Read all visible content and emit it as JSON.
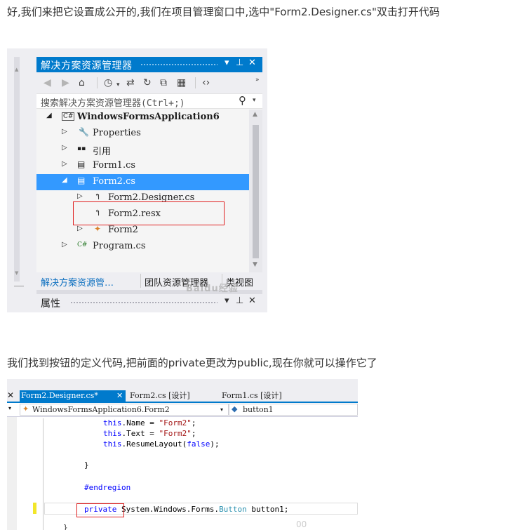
{
  "text": {
    "para1": "好,我们来把它设置成公开的,我们在项目管理窗口中,选中\"Form2.Designer.cs\"双击打开代码",
    "para2": "我们找到按钮的定义代码,把前面的private更改为public,现在你就可以操作它了"
  },
  "solution_explorer": {
    "title": "解决方案资源管理器",
    "title_controls": [
      "▾",
      "⊥",
      "✕"
    ],
    "search_placeholder": "搜索解决方案资源管理器(Ctrl+;)",
    "tree": [
      {
        "label": "WindowsFormsApplication6",
        "icon": "C#",
        "expander": "◢",
        "indent": 0,
        "bold": true
      },
      {
        "label": "Properties",
        "icon": "🔧",
        "expander": "▷",
        "indent": 1
      },
      {
        "label": "引用",
        "icon": "▪▪",
        "expander": "▷",
        "indent": 1
      },
      {
        "label": "Form1.cs",
        "icon": "▤",
        "expander": "▷",
        "indent": 1
      },
      {
        "label": "Form2.cs",
        "icon": "▤",
        "expander": "◢",
        "indent": 1,
        "selected": true
      },
      {
        "label": "Form2.Designer.cs",
        "icon": "↰",
        "expander": "▷",
        "indent": 2
      },
      {
        "label": "Form2.resx",
        "icon": "↰",
        "expander": "",
        "indent": 2
      },
      {
        "label": "Form2",
        "icon": "✦",
        "expander": "▷",
        "indent": 2
      },
      {
        "label": "Program.cs",
        "icon": "C#",
        "expander": "▷",
        "indent": 1
      }
    ],
    "tabs": [
      "解决方案资源管…",
      "团队资源管理器",
      "类视图"
    ],
    "props_title": "属性",
    "watermark": "Baidu经验"
  },
  "editor": {
    "tabs": [
      {
        "label": "Form2.Designer.cs*",
        "active": true
      },
      {
        "label": "Form2.cs [设计]"
      },
      {
        "label": "Form1.cs [设计]"
      }
    ],
    "nav_left": "WindowsFormsApplication6.Form2",
    "nav_right": "button1",
    "code": {
      "line1": [
        "this",
        ".Name = ",
        "\"Form2\"",
        ";"
      ],
      "line2": [
        "this",
        ".Text = ",
        "\"Form2\"",
        ";"
      ],
      "line3": [
        "this",
        ".ResumeLayout(",
        "false",
        ");"
      ],
      "line4": "}",
      "line5": "#endregion",
      "line6": [
        "private",
        " System.Windows.Forms.",
        "Button",
        " button1;"
      ],
      "line7": "}"
    },
    "watermark": "00"
  },
  "colors": {
    "accent": "#007acc",
    "selection": "#3399ff",
    "highlight_box": "#e02020",
    "keyword": "#0000ff",
    "string": "#a31515",
    "type": "#2b91af"
  }
}
